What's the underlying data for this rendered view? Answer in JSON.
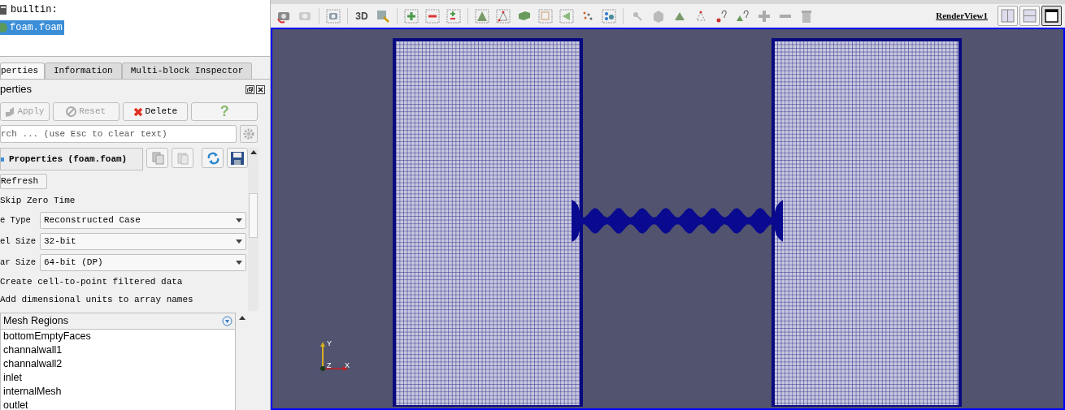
{
  "pipeline": {
    "items": [
      {
        "label": "builtin:",
        "kind": "server",
        "selected": false
      },
      {
        "label": "foam.foam",
        "kind": "source",
        "selected": true
      }
    ]
  },
  "tabs": [
    {
      "label": "perties",
      "selected": true
    },
    {
      "label": "Information",
      "selected": false
    },
    {
      "label": "Multi-block Inspector",
      "selected": false
    }
  ],
  "panel_title": "perties",
  "buttons": [
    {
      "label": "Apply",
      "kind": "apply",
      "disabled": true
    },
    {
      "label": "Reset",
      "kind": "reset",
      "disabled": true
    },
    {
      "label": "Delete",
      "kind": "delete",
      "disabled": false
    },
    {
      "label": "?",
      "kind": "help",
      "disabled": false
    }
  ],
  "search": {
    "placeholder": "rch ... (use Esc to clear text)"
  },
  "section_title": "Properties (foam.foam)",
  "refresh_button": "Refresh",
  "properties": [
    {
      "kind": "option",
      "label": "Skip Zero Time"
    },
    {
      "kind": "dropdown",
      "label": "e Type",
      "value": "Reconstructed Case"
    },
    {
      "kind": "dropdown",
      "label": "el Size",
      "value": "32-bit"
    },
    {
      "kind": "dropdown",
      "label": "ar Size",
      "value": "64-bit (DP)"
    },
    {
      "kind": "option",
      "label": "Create cell-to-point filtered data"
    },
    {
      "kind": "option",
      "label": "Add dimensional units to array names"
    }
  ],
  "mesh_regions": {
    "header": "Mesh Regions",
    "items": [
      "bottomEmptyFaces",
      "channalwall1",
      "channalwall2",
      "inlet",
      "internalMesh",
      "outlet"
    ]
  },
  "toolbar": {
    "three_d": "3D",
    "view_name": "RenderView1",
    "layouts": [
      {
        "kind": "split-h",
        "selected": false
      },
      {
        "kind": "split-v",
        "selected": false
      },
      {
        "kind": "maximize",
        "selected": true
      }
    ]
  },
  "axes": {
    "y": "Y",
    "z": "Z",
    "x": "X"
  }
}
